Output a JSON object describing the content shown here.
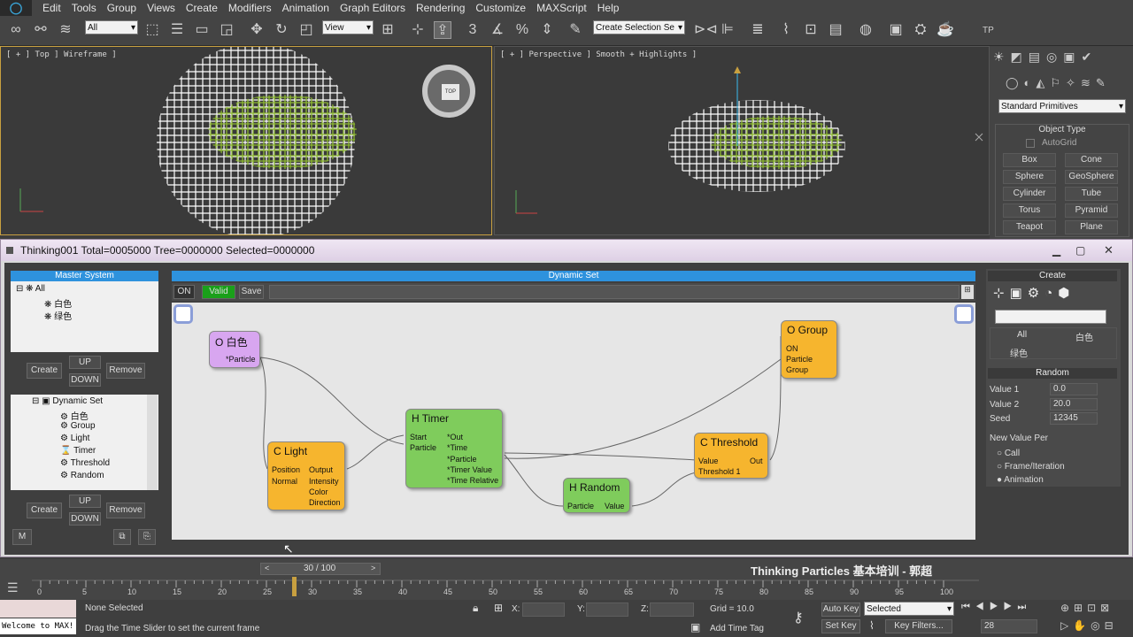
{
  "menu": [
    "Edit",
    "Tools",
    "Group",
    "Views",
    "Create",
    "Modifiers",
    "Animation",
    "Graph Editors",
    "Rendering",
    "Customize",
    "MAXScript",
    "Help"
  ],
  "toolbar": {
    "filter": "All",
    "refcoord": "View",
    "selset": "Create Selection Se",
    "tp_label": "TP"
  },
  "viewports": {
    "top": {
      "label": "[ + ] Top ] Wireframe ]",
      "cube_label": "TOP"
    },
    "persp": {
      "label": "[ + ] Perspective ] Smooth + Highlights ]"
    }
  },
  "cmdpanel": {
    "category": "Standard Primitives",
    "section": "Object Type",
    "autogrid": "AutoGrid",
    "buttons": [
      "Box",
      "Cone",
      "Sphere",
      "GeoSphere",
      "Cylinder",
      "Tube",
      "Torus",
      "Pyramid",
      "Teapot",
      "Plane"
    ]
  },
  "tp": {
    "title": "Thinking001  Total=0005000  Tree=0000000  Selected=0000000",
    "master": {
      "head": "Master System",
      "all": "All",
      "g1": "白色",
      "g2": "绿色"
    },
    "buttons": {
      "create": "Create",
      "up": "UP",
      "down": "DOWN",
      "remove": "Remove",
      "m": "M"
    },
    "dyntree": {
      "root": "Dynamic Set",
      "items": [
        "白色",
        "Group",
        "Light",
        "Timer",
        "Threshold",
        "Random"
      ]
    },
    "dynset": {
      "head": "Dynamic Set",
      "on": "ON",
      "valid": "Valid",
      "save": "Save"
    },
    "nodes": {
      "white": {
        "title": "O 白色",
        "p1": "*Particle"
      },
      "group": {
        "title": "O Group",
        "p1": "ON",
        "p2": "Particle",
        "p3": "Group"
      },
      "light": {
        "title": "C Light",
        "in1": "Position",
        "in2": "Normal",
        "out1": "Output",
        "out2": "Intensity",
        "out3": "Color",
        "out4": "Direction"
      },
      "timer": {
        "title": "H Timer",
        "in1": "Start",
        "in2": "Particle",
        "out1": "*Out",
        "out2": "*Time",
        "out3": "*Particle",
        "out4": "*Timer Value",
        "out5": "*Time Relative"
      },
      "threshold": {
        "title": "C Threshold",
        "in1": "Value",
        "in2": "Threshold 1",
        "out1": "Out"
      },
      "random": {
        "title": "H Random",
        "in1": "Particle",
        "out1": "Value"
      }
    },
    "right": {
      "create_head": "Create",
      "tabs": [
        "All",
        "白色",
        "绿色"
      ],
      "random_head": "Random",
      "v1_label": "Value 1",
      "v1": "0.0",
      "v2_label": "Value 2",
      "v2": "20.0",
      "seed_label": "Seed",
      "seed": "12345",
      "nvp": "New Value Per",
      "opt1": "Call",
      "opt2": "Frame/Iteration",
      "opt3": "Animation"
    }
  },
  "timeline": {
    "frame": "30 / 100",
    "caption": "Thinking Particles 基本培训 - 郭超",
    "ticks": [
      "0",
      "5",
      "10",
      "15",
      "20",
      "25",
      "30",
      "35",
      "40",
      "45",
      "50",
      "55",
      "60",
      "65",
      "70",
      "75",
      "80",
      "85",
      "90",
      "95",
      "100"
    ]
  },
  "status": {
    "welcome": "Welcome to MAX!",
    "selected": "None Selected",
    "hint": "Drag the Time Slider to set the current frame",
    "x": "X:",
    "y": "Y:",
    "z": "Z:",
    "grid": "Grid = 10.0",
    "addtag": "Add Time Tag",
    "autokey": "Auto Key",
    "setkey": "Set Key",
    "keymode": "Selected",
    "keyfilters": "Key Filters...",
    "frame": "28"
  },
  "colors": {
    "blue_head": "#2e92dd",
    "node_orange": "#f6b52e",
    "node_green": "#7fcc5c",
    "node_purple": "#d8a6f0",
    "valid": "#1aa01a"
  }
}
